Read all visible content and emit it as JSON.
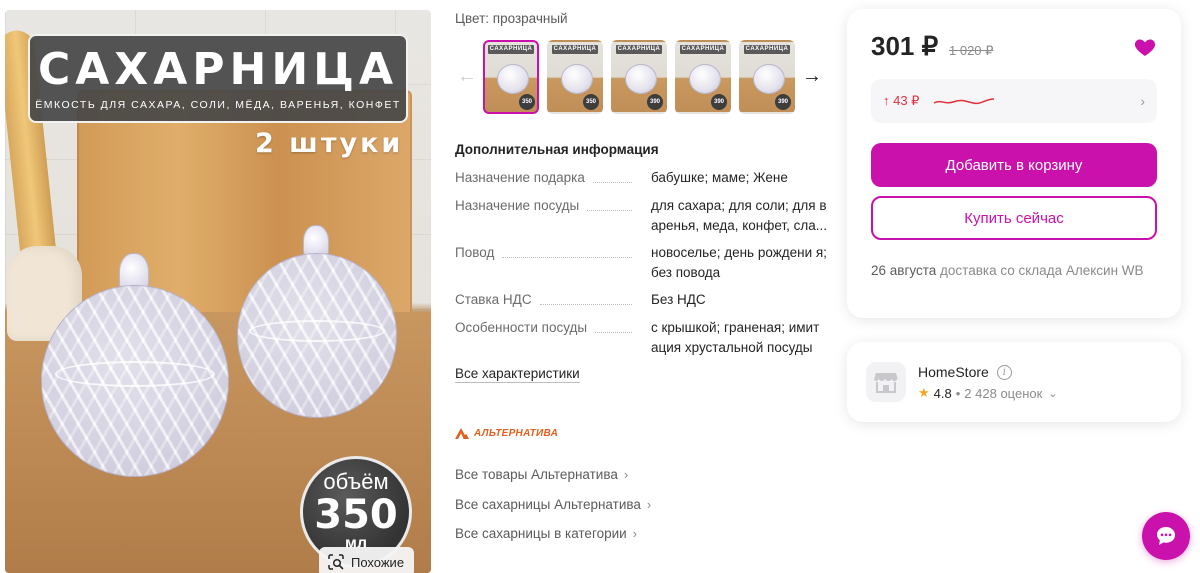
{
  "gallery": {
    "title": "САХАРНИЦА",
    "subtitle": "ЁМКОСТЬ ДЛЯ САХАРА, СОЛИ, МЁДА, ВАРЕНЬЯ, КОНФЕТ",
    "quantity": "2 штуки",
    "volume_word": "объём",
    "volume_value": "350",
    "volume_unit": "мл",
    "similar_label": "Похожие"
  },
  "variant": {
    "color_label": "Цвет:",
    "color_value": "прозрачный",
    "thumbnails": [
      {
        "label": "САХАРНИЦА",
        "badge": "350",
        "active": true
      },
      {
        "label": "САХАРНИЦА",
        "badge": "350",
        "active": false
      },
      {
        "label": "САХАРНИЦА",
        "badge": "390",
        "active": false
      },
      {
        "label": "САХАРНИЦА",
        "badge": "390",
        "active": false
      },
      {
        "label": "САХАРНИЦА",
        "badge": "390",
        "active": false
      }
    ]
  },
  "specs": {
    "title": "Дополнительная информация",
    "rows": [
      {
        "key": "Назначение подарка",
        "value": "бабушке; маме; Жене"
      },
      {
        "key": "Назначение посуды",
        "value": "для сахара; для соли; для в аренья, меда, конфет, сла..."
      },
      {
        "key": "Повод",
        "value": "новоселье; день рождени я; без повода"
      },
      {
        "key": "Ставка НДС",
        "value": "Без НДС"
      },
      {
        "key": "Особенности посуды",
        "value": "с крышкой; граненая; имит ация хрустальной посуды"
      }
    ],
    "all_link": "Все характеристики"
  },
  "brand": {
    "logo_text": "АЛЬТЕРНАТИВА",
    "links": [
      "Все товары Альтернатива",
      "Все сахарницы Альтернатива",
      "Все сахарницы в категории"
    ]
  },
  "buy": {
    "price": "301 ₽",
    "old_price": "1 020 ₽",
    "price_change": "↑ 43 ₽",
    "add_to_cart": "Добавить в корзину",
    "buy_now": "Купить сейчас",
    "delivery_date": "26 августа",
    "delivery_text": "доставка со склада Алексин WB",
    "accent_color": "#cb11ab",
    "price_up_color": "#e0313d"
  },
  "seller": {
    "name": "HomeStore",
    "rating": "4.8",
    "reviews": "2 428 оценок"
  },
  "icons": {
    "heart": "heart-icon",
    "chat": "chat-icon",
    "search_similar": "image-search-icon",
    "store": "store-icon"
  }
}
